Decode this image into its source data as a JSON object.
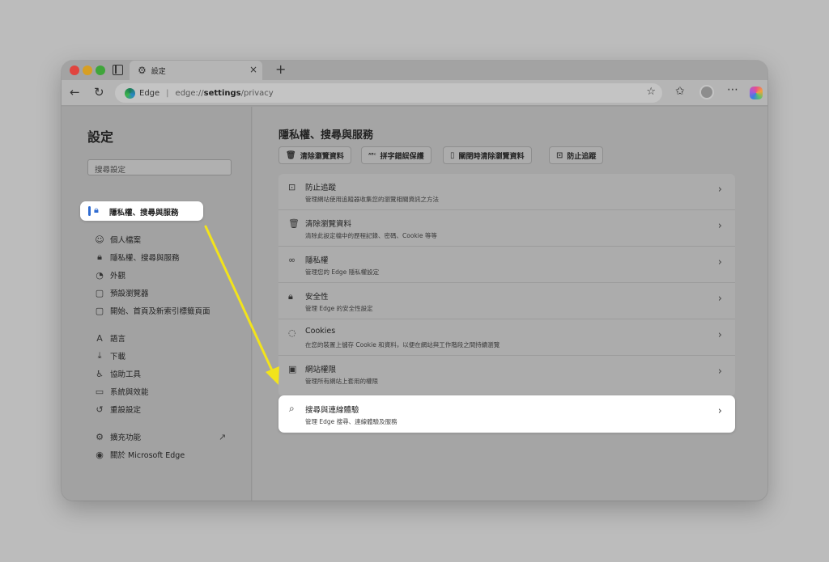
{
  "browser": {
    "tab_title": "設定",
    "new_tab": "+",
    "address": {
      "site_label": "Edge",
      "separator": "|",
      "scheme": "edge://",
      "host": "settings",
      "path": "/privacy"
    }
  },
  "sidebar": {
    "title": "設定",
    "search_placeholder": "搜尋設定",
    "items": [
      {
        "label": "個人檔案",
        "icon": "profile-icon"
      },
      {
        "label": "隱私權、搜尋與服務",
        "icon": "lock-icon",
        "selected": true
      },
      {
        "label": "外觀",
        "icon": "palette-icon"
      },
      {
        "label": "預設瀏覽器",
        "icon": "browser-icon"
      },
      {
        "label": "開始、首頁及新索引標籤頁面",
        "icon": "home-icon"
      },
      {
        "label": "語言",
        "icon": "language-icon"
      },
      {
        "label": "下載",
        "icon": "download-icon"
      },
      {
        "label": "協助工具",
        "icon": "accessibility-icon"
      },
      {
        "label": "系統與效能",
        "icon": "system-icon"
      },
      {
        "label": "重設設定",
        "icon": "reset-icon"
      },
      {
        "label": "擴充功能",
        "icon": "extensions-icon"
      },
      {
        "label": "關於 Microsoft Edge",
        "icon": "edge-icon"
      }
    ]
  },
  "main": {
    "title": "隱私權、搜尋與服務",
    "chips": [
      {
        "label": "清除瀏覽資料",
        "icon": "trash-icon"
      },
      {
        "label": "拼字錯誤保護",
        "icon": "spellcheck-icon"
      },
      {
        "label": "關閉時清除瀏覽資料",
        "icon": "clear-on-close-icon"
      },
      {
        "label": "防止追蹤",
        "icon": "tracking-icon"
      }
    ],
    "rows": [
      {
        "title": "防止追蹤",
        "desc": "管理網站使用追蹤器收集您的瀏覽相關資訊之方法",
        "icon": "tracking-icon"
      },
      {
        "title": "清除瀏覽資料",
        "desc": "清除此設定檔中的歷程記錄、密碼、Cookie 等等",
        "icon": "trash-icon"
      },
      {
        "title": "隱私權",
        "desc": "管理您的 Edge 隱私權設定",
        "icon": "glasses-icon"
      },
      {
        "title": "安全性",
        "desc": "管理 Edge 的安全性設定",
        "icon": "lock-icon"
      },
      {
        "title": "Cookies",
        "desc": "在您的裝置上儲存 Cookie 和資料，以便在網站與工作階段之間持續瀏覽",
        "icon": "cookie-icon"
      },
      {
        "title": "網站權限",
        "desc": "管理所有網站上套用的權限",
        "icon": "permissions-icon"
      }
    ],
    "highlight_row": {
      "title": "搜尋與連線體驗",
      "desc": "管理 Edge 搜尋、連線體驗及服務",
      "icon": "search-icon"
    }
  },
  "colors": {
    "accent": "#2f6bd1",
    "arrow": "#f2e31b"
  }
}
